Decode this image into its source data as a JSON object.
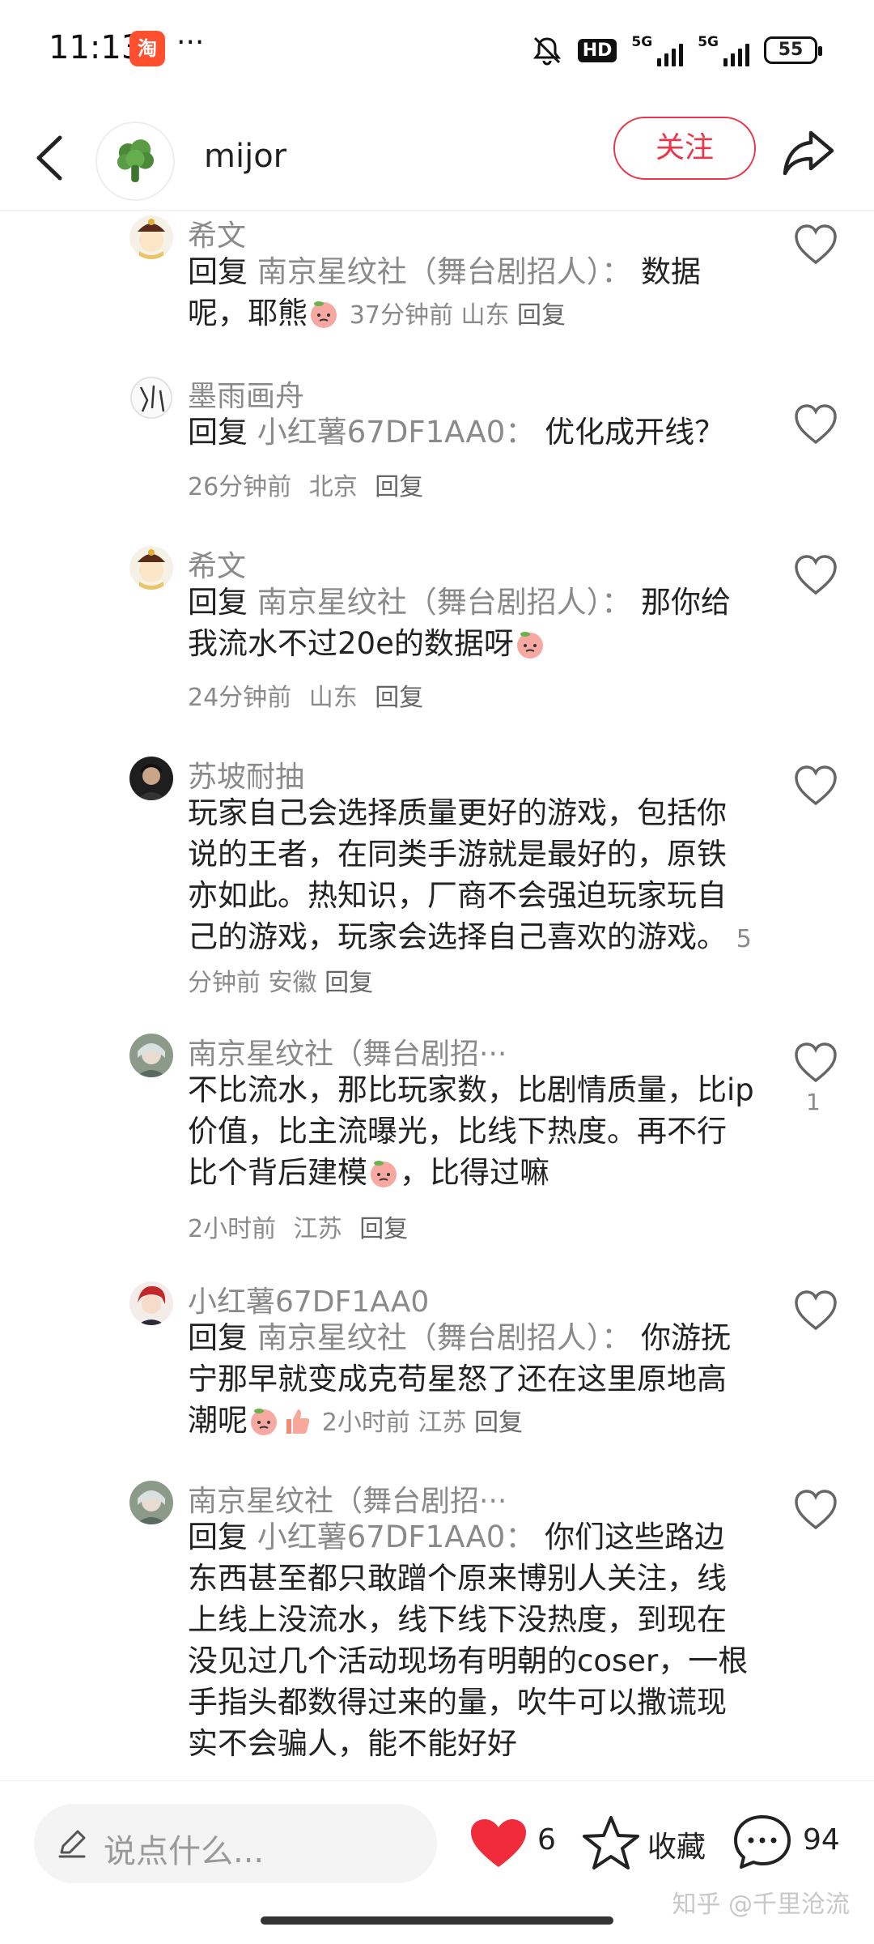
{
  "status_bar": {
    "time": "11:13",
    "app_badge": "淘",
    "more": "···",
    "hd": "HD",
    "net1": "5G",
    "net2": "5G",
    "battery": "55"
  },
  "header": {
    "author_name": "mijor",
    "follow_label": "关注"
  },
  "comments": [
    {
      "name": "希文",
      "reply_keyword": "回复",
      "reply_target": "南京星纹社（舞台剧招人）：",
      "text": "数据呢，耶熊",
      "emoji": "peach",
      "time": "37分钟前",
      "location": "山东",
      "reply_label": "回复"
    },
    {
      "name": "墨雨画舟",
      "reply_keyword": "回复",
      "reply_target": "小红薯67DF1AA0：",
      "text": "优化成开线？",
      "time": "26分钟前",
      "location": "北京",
      "reply_label": "回复"
    },
    {
      "name": "希文",
      "reply_keyword": "回复",
      "reply_target": "南京星纹社（舞台剧招人）：",
      "text": "那你给我流水不过20e的数据呀",
      "emoji": "peach",
      "time": "24分钟前",
      "location": "山东",
      "reply_label": "回复"
    },
    {
      "name": "苏坡耐抽",
      "text": "玩家自己会选择质量更好的游戏，包括你说的王者，在同类手游就是最好的，原铁亦如此。热知识，厂商不会强迫玩家玩自己的游戏，玩家会选择自己喜欢的游戏。",
      "time": "5分钟前",
      "location": "安徽",
      "reply_label": "回复"
    },
    {
      "name": "南京星纹社（舞台剧招···",
      "text_a": "不比流水，那比玩家数，比剧情质量，比ip价值，比主流曝光，比线下热度。再不行比个背后建模",
      "text_b": "，比得过嘛",
      "emoji": "peach",
      "time": "2小时前",
      "location": "江苏",
      "reply_label": "回复",
      "like_count": "1"
    },
    {
      "name": "小红薯67DF1AA0",
      "reply_keyword": "回复",
      "reply_target": "南京星纹社（舞台剧招人）：",
      "text": "你游抚宁那早就变成克苟星怒了还在这里原地高潮呢",
      "emoji": "peach",
      "emoji2": "thumb",
      "time": "2小时前",
      "location": "江苏",
      "reply_label": "回复"
    },
    {
      "name": "南京星纹社（舞台剧招···",
      "reply_keyword": "回复",
      "reply_target": "小红薯67DF1AA0：",
      "text": "你们这些路边东西甚至都只敢蹭个原来博别人关注，线上线上没流水，线下线下没热度，到现在没见过几个活动现场有明朝的coser，一根手指头都数得过来的量，吹牛可以撒谎现实不会骗人，能不能好好"
    }
  ],
  "bottom_bar": {
    "input_placeholder": "说点什么...",
    "like_count": "6",
    "favorite_label": "收藏",
    "comment_count": "94"
  },
  "watermark": "知乎 @千里沧流",
  "colors": {
    "accent": "#e8364a",
    "heart": "#f02b3c",
    "meta": "#8a8a8a"
  }
}
